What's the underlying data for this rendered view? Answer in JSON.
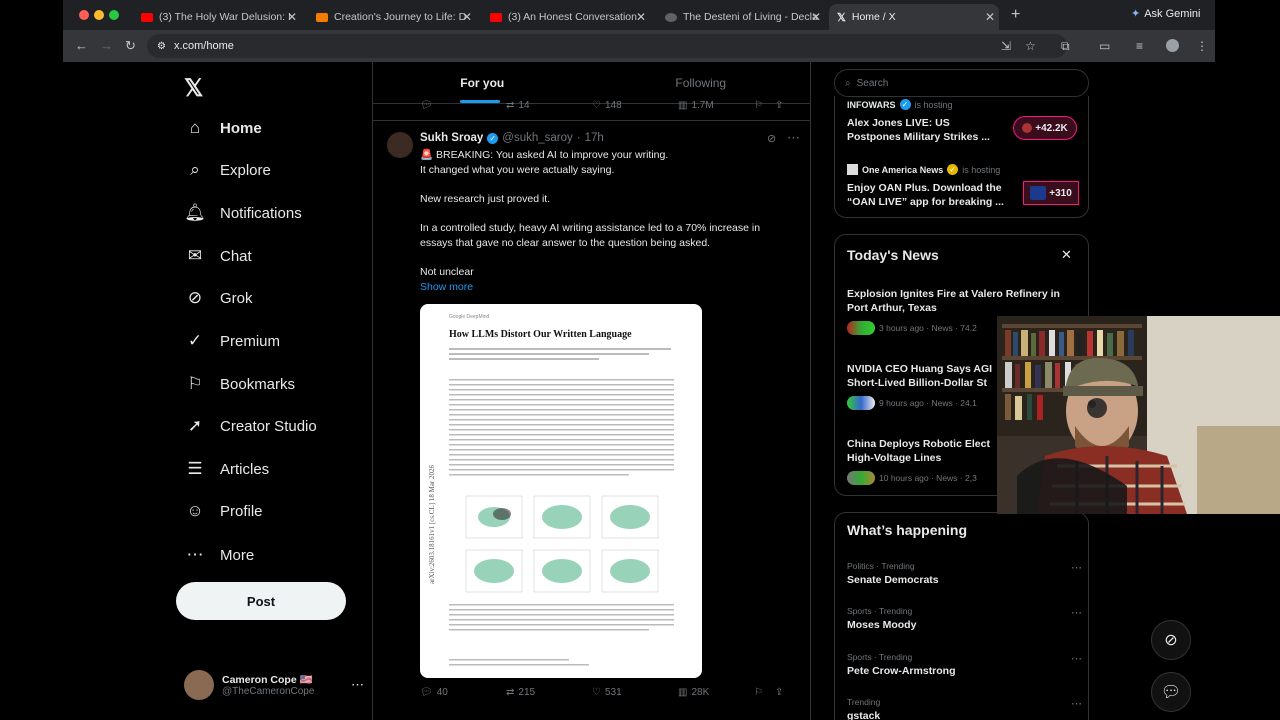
{
  "browser": {
    "tabs": [
      {
        "label": "(3) The Holy War Delusion: I",
        "color": "#ff0000"
      },
      {
        "label": "Creation's Journey to Life: D",
        "color": "#f57c00"
      },
      {
        "label": "(3) An Honest Conversation",
        "color": "#ff0000"
      },
      {
        "label": "The Desteni of Living - Decla",
        "color": "#5f6368"
      },
      {
        "label": "Home / X",
        "color": "#ffffff"
      }
    ],
    "url": "x.com/home",
    "gemini_label": "Ask Gemini"
  },
  "nav": {
    "items": [
      {
        "label": "Home",
        "icon": "home-icon"
      },
      {
        "label": "Explore",
        "icon": "search-icon"
      },
      {
        "label": "Notifications",
        "icon": "bell-icon"
      },
      {
        "label": "Chat",
        "icon": "mail-icon"
      },
      {
        "label": "Grok",
        "icon": "grok-icon"
      },
      {
        "label": "Premium",
        "icon": "check-badge-icon"
      },
      {
        "label": "Bookmarks",
        "icon": "bookmark-icon"
      },
      {
        "label": "Creator Studio",
        "icon": "rocket-icon"
      },
      {
        "label": "Articles",
        "icon": "article-icon"
      },
      {
        "label": "Profile",
        "icon": "person-icon"
      },
      {
        "label": "More",
        "icon": "more-circle-icon"
      }
    ],
    "post_label": "Post",
    "account": {
      "name": "Cameron Cope 🇺🇸",
      "handle": "@TheCameronCope"
    }
  },
  "feed": {
    "tabs": [
      "For you",
      "Following"
    ],
    "prev_stats": {
      "replies": "",
      "reposts": "14",
      "likes": "148",
      "views": "1.7M"
    },
    "tweet": {
      "name": "Sukh Sroay",
      "handle": "@sukh_saroy",
      "time": "17h",
      "lines": [
        "🚨 BREAKING: You asked AI to improve your writing.",
        "It changed what you were actually saying.",
        "New research just proved it.",
        "In a controlled study, heavy AI writing assistance led to a 70% increase in",
        "essays that gave no clear answer to the question being asked.",
        "Not unclear"
      ],
      "show_more": "Show more",
      "paper_title": "How LLMs Distort Our Written Language",
      "paper_header": "Google DeepMind",
      "paper_arxiv": "arXiv:2603.18161v1 [cs.CL] 18 Mar 2026",
      "stats": {
        "replies": "40",
        "reposts": "215",
        "likes": "531",
        "views": "28K"
      }
    }
  },
  "sidebar": {
    "search_placeholder": "Search",
    "live": [
      {
        "host": "INFOWARS",
        "status": "is hosting",
        "title1": "Alex Jones LIVE: US",
        "title2": "Postpones Military Strikes ...",
        "badge": "+42.2K"
      },
      {
        "host": "One America News",
        "status": "is hosting",
        "title1": "Enjoy OAN Plus. Download the",
        "title2": "“OAN LIVE” app for breaking ...",
        "badge": "+310"
      }
    ],
    "news_heading": "Today's News",
    "news": [
      {
        "title1": "Explosion Ignites Fire at Valero Refinery in",
        "title2": "Port Arthur, Texas",
        "meta": "3 hours ago · News · 74.2"
      },
      {
        "title1": "NVIDIA CEO Huang Says AGI",
        "title2": "Short-Lived Billion-Dollar St",
        "meta": "9 hours ago · News · 24.1"
      },
      {
        "title1": "China Deploys Robotic Elect",
        "title2": "High-Voltage Lines",
        "meta": "10 hours ago · News · 2,3"
      }
    ],
    "happening_heading": "What’s happening",
    "trends": [
      {
        "context": "Politics · Trending",
        "name": "Senate Democrats"
      },
      {
        "context": "Sports · Trending",
        "name": "Moses Moody"
      },
      {
        "context": "Sports · Trending",
        "name": "Pete Crow-Armstrong"
      },
      {
        "context": "Trending",
        "name": "gstack"
      }
    ]
  }
}
